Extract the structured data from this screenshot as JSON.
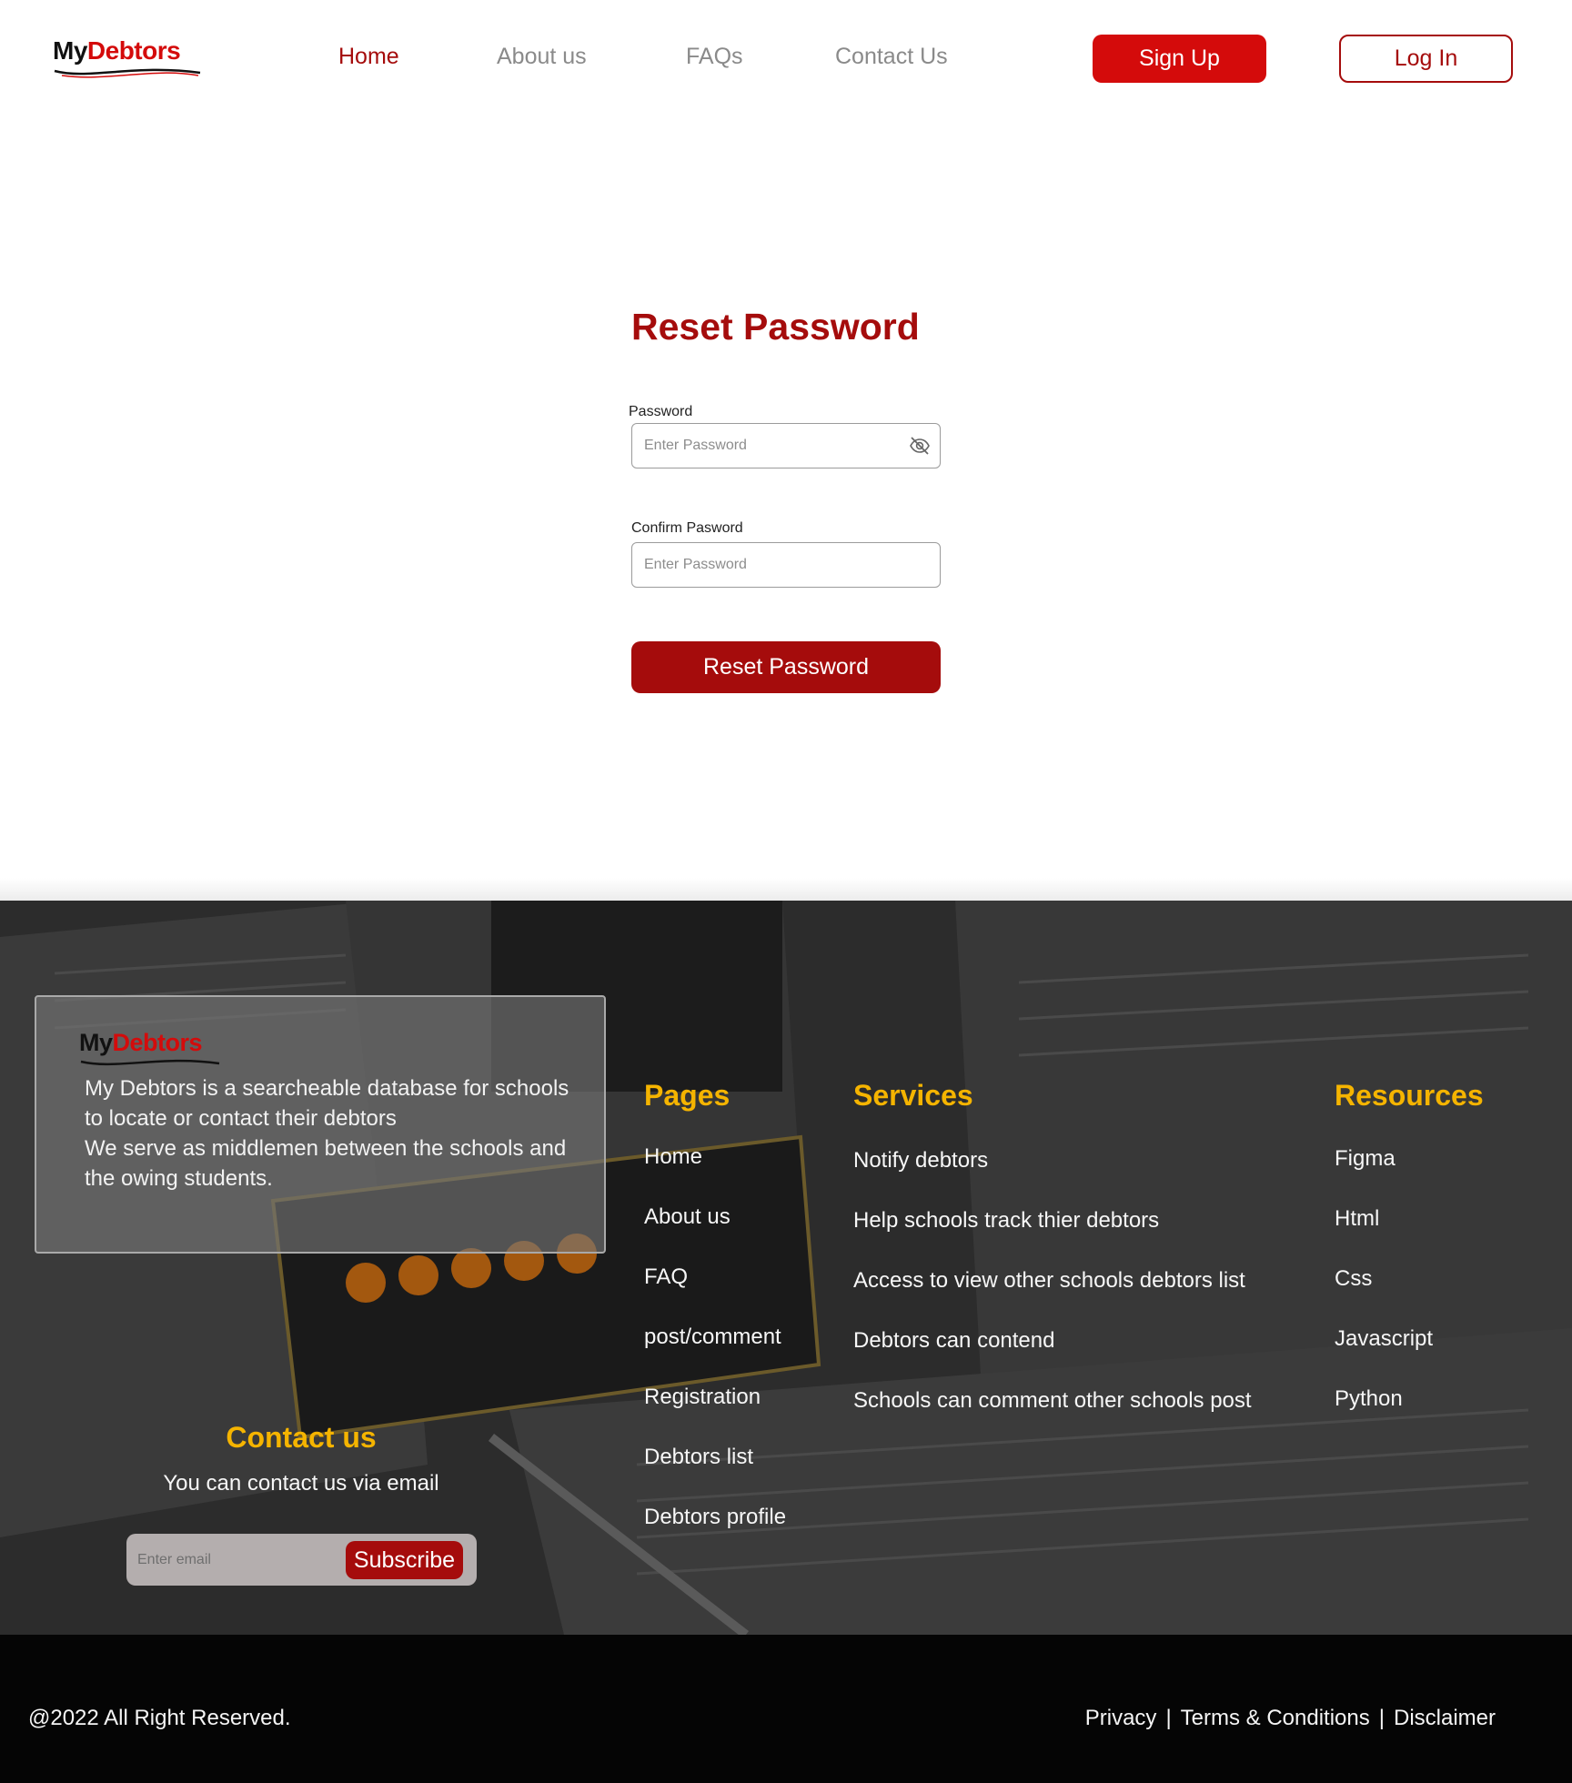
{
  "brand": {
    "logo_prefix": "My",
    "logo_suffix": "Debtors",
    "red": "#d40b0b",
    "dark_red": "#a50c0c",
    "gold": "#f5b400"
  },
  "nav": {
    "home": "Home",
    "about": "About us",
    "faqs": "FAQs",
    "contact": "Contact Us",
    "signup": "Sign Up",
    "login": "Log In"
  },
  "form": {
    "title": "Reset Password",
    "password_label": "Password",
    "password_placeholder": "Enter Password",
    "password_icon": "eye-slash-icon",
    "confirm_label": "Confirm Pasword",
    "confirm_placeholder": "Enter Password",
    "submit": "Reset Password"
  },
  "footer": {
    "about_lines": [
      "My Debtors is a searcheable database for schools to locate or contact their debtors",
      "We serve as middlemen between the schools and the owing students."
    ],
    "pages": {
      "title": "Pages",
      "items": [
        "Home",
        "About us",
        "FAQ",
        "post/comment",
        "Registration",
        "Debtors list",
        "Debtors profile"
      ]
    },
    "services": {
      "title": "Services",
      "items": [
        "Notify debtors",
        "Help schools track thier debtors",
        "Access to view other schools debtors list",
        "Debtors can contend",
        "Schools can comment other schools post"
      ]
    },
    "resources": {
      "title": "Resources",
      "items": [
        "Figma",
        "Html",
        "Css",
        "Javascript",
        "Python"
      ]
    },
    "contact": {
      "title": "Contact us",
      "subtitle": "You can contact us via email",
      "email_placeholder": "Enter email",
      "subscribe": "Subscribe"
    }
  },
  "bottom": {
    "copyright": "@2022 All Right Reserved.",
    "privacy": "Privacy",
    "terms": "Terms & Conditions",
    "disclaimer": "Disclaimer",
    "separator": "|"
  }
}
